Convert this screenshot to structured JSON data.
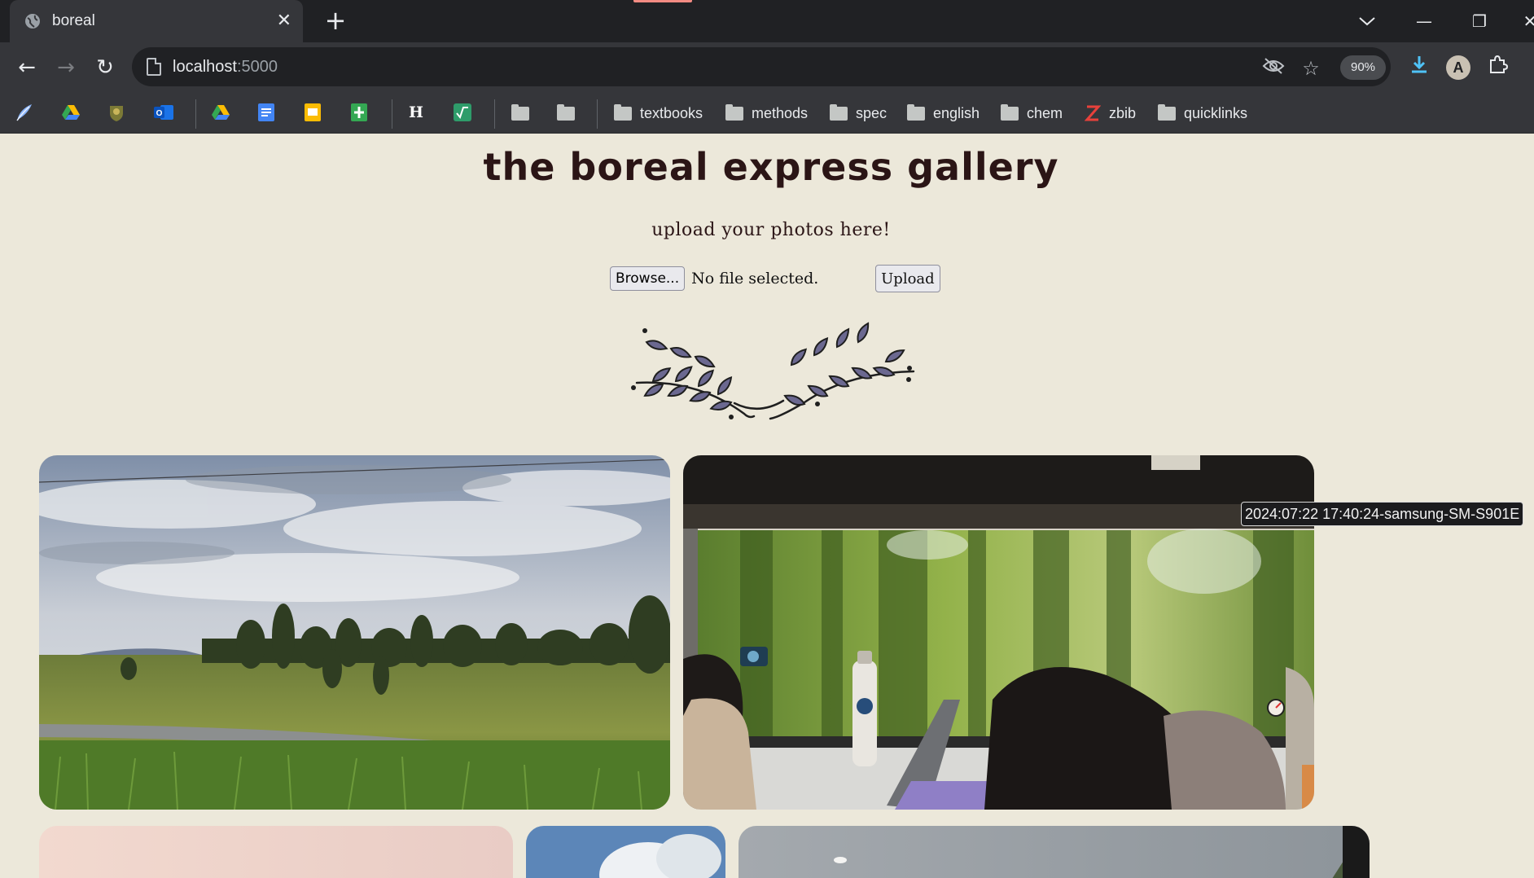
{
  "browser": {
    "tab_title": "boreal",
    "url_host": "localhost",
    "url_port": ":5000",
    "zoom": "90%",
    "profile_initial": "A",
    "bookmark_folders": [
      "textbooks",
      "methods",
      "spec",
      "english",
      "chem",
      "zbib",
      "quicklinks"
    ]
  },
  "page": {
    "title": "the boreal express gallery",
    "subtitle": "upload your photos here!",
    "browse_label": "Browse...",
    "file_status": "No file selected.",
    "upload_label": "Upload",
    "tooltip": "2024:07:22 17:40:24-samsung-SM-S901E"
  },
  "colors": {
    "page_bg": "#ece8da",
    "heading": "#2b1516",
    "leaf": "#6b6890",
    "chrome_dark": "#202124",
    "chrome": "#35363a"
  }
}
